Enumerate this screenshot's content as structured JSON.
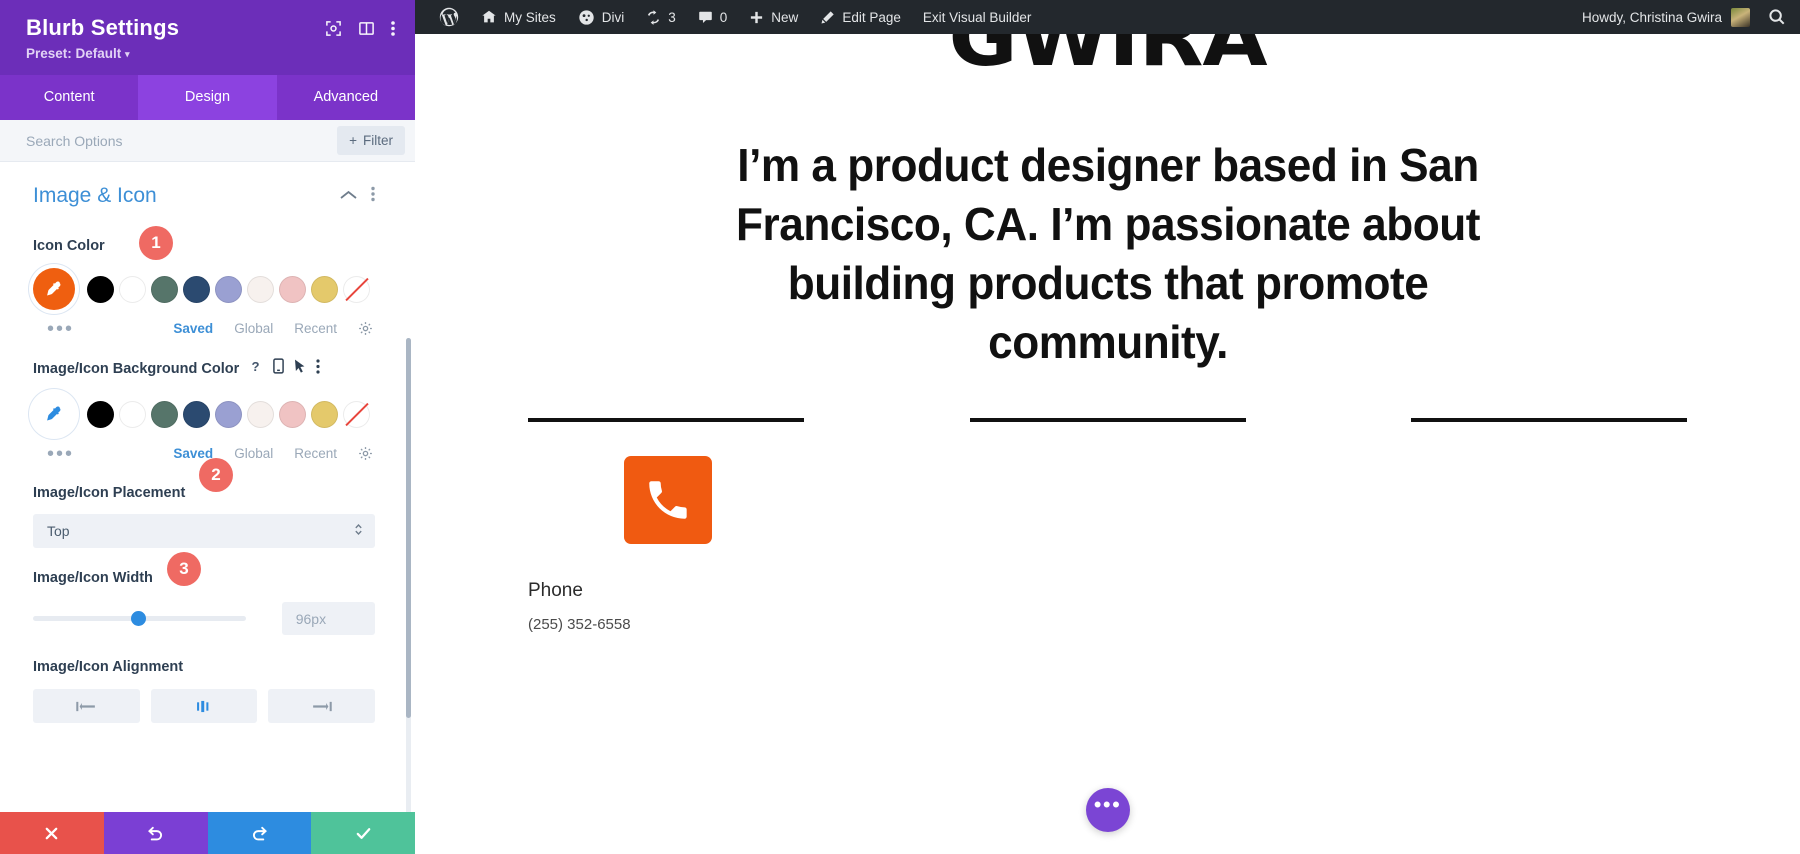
{
  "sidebar": {
    "title": "Blurb Settings",
    "preset": "Preset: Default",
    "preset_caret": "▾",
    "header_icons": [
      {
        "name": "focus-target-icon"
      },
      {
        "name": "layout-columns-icon"
      },
      {
        "name": "kebab-menu-icon"
      }
    ],
    "tabs": [
      {
        "label": "Content",
        "active": false
      },
      {
        "label": "Design",
        "active": true
      },
      {
        "label": "Advanced",
        "active": false
      }
    ],
    "search": {
      "placeholder": "Search Options",
      "value": ""
    },
    "filter_button": {
      "label": "Filter",
      "plus": "+"
    },
    "section": {
      "title": "Image & Icon",
      "collapse_icon": "chevron-up-icon",
      "menu_icon": "kebab-menu-icon"
    },
    "fields": {
      "icon_color": {
        "label": "Icon Color",
        "badge": "1",
        "picker_color": "#ef5f10",
        "picker_icon": "eyedropper-icon",
        "swatches": [
          "#000000",
          "#ffffff",
          "#56756a",
          "#2b4a70",
          "#9aa0d2",
          "#f7f1ee",
          "#f0c3c3",
          "#e4c96b"
        ],
        "none_swatch": "none",
        "more_dots": "•••",
        "tabs": [
          {
            "label": "Saved",
            "active": true
          },
          {
            "label": "Global",
            "active": false
          },
          {
            "label": "Recent",
            "active": false
          }
        ],
        "gear_icon": "gear-icon"
      },
      "bg_color": {
        "label": "Image/Icon Background Color",
        "icons": [
          "help-icon",
          "mobile-icon",
          "cursor-icon",
          "kebab-menu-icon"
        ],
        "picker_color": "#ffffff",
        "picker_icon": "eyedropper-icon",
        "swatches": [
          "#000000",
          "#ffffff",
          "#56756a",
          "#2b4a70",
          "#9aa0d2",
          "#f7f1ee",
          "#f0c3c3",
          "#e4c96b"
        ],
        "none_swatch": "none",
        "more_dots": "•••",
        "tabs": [
          {
            "label": "Saved",
            "active": true
          },
          {
            "label": "Global",
            "active": false
          },
          {
            "label": "Recent",
            "active": false
          }
        ],
        "gear_icon": "gear-icon"
      },
      "placement": {
        "label": "Image/Icon Placement",
        "badge": "2",
        "value": "Top",
        "chevron": "updown-chevron-icon"
      },
      "width": {
        "label": "Image/Icon Width",
        "badge": "3",
        "value": "96px",
        "slider_percent": 46
      },
      "alignment": {
        "label": "Image/Icon Alignment",
        "options": [
          "align-left-icon",
          "align-center-icon",
          "align-right-icon"
        ]
      }
    },
    "footer": [
      {
        "name": "cancel-button",
        "icon": "close-icon",
        "color": "#e8524b"
      },
      {
        "name": "undo-button",
        "icon": "undo-icon",
        "color": "#7b3fd4"
      },
      {
        "name": "redo-button",
        "icon": "redo-icon",
        "color": "#2d8ce0"
      },
      {
        "name": "save-button",
        "icon": "check-icon",
        "color": "#4fc39a"
      }
    ]
  },
  "admin_bar": {
    "items": [
      {
        "label": "",
        "icon": "wordpress-logo-icon"
      },
      {
        "label": "My Sites",
        "icon": "sites-icon"
      },
      {
        "label": "Divi",
        "icon": "divi-icon"
      },
      {
        "label": "3",
        "icon": "updates-icon"
      },
      {
        "label": "0",
        "icon": "comments-icon"
      },
      {
        "label": "New",
        "icon": "plus-icon"
      },
      {
        "label": "Edit Page",
        "icon": "pencil-icon"
      },
      {
        "label": "Exit Visual Builder",
        "icon": ""
      }
    ],
    "howdy": "Howdy, Christina Gwira",
    "search_icon": "search-icon"
  },
  "page": {
    "logo": "GWIRA",
    "headline": "I’m a product designer based in San Francisco, CA. I’m passionate about building products that promote community.",
    "rules_count": 3,
    "blurb": {
      "icon": "phone-icon",
      "icon_color": "#f05a11",
      "title": "Phone",
      "text": "(255) 352-6558"
    },
    "fab": {
      "icon": "more-dots-icon",
      "label": "•••",
      "color": "#7b45d4"
    }
  }
}
